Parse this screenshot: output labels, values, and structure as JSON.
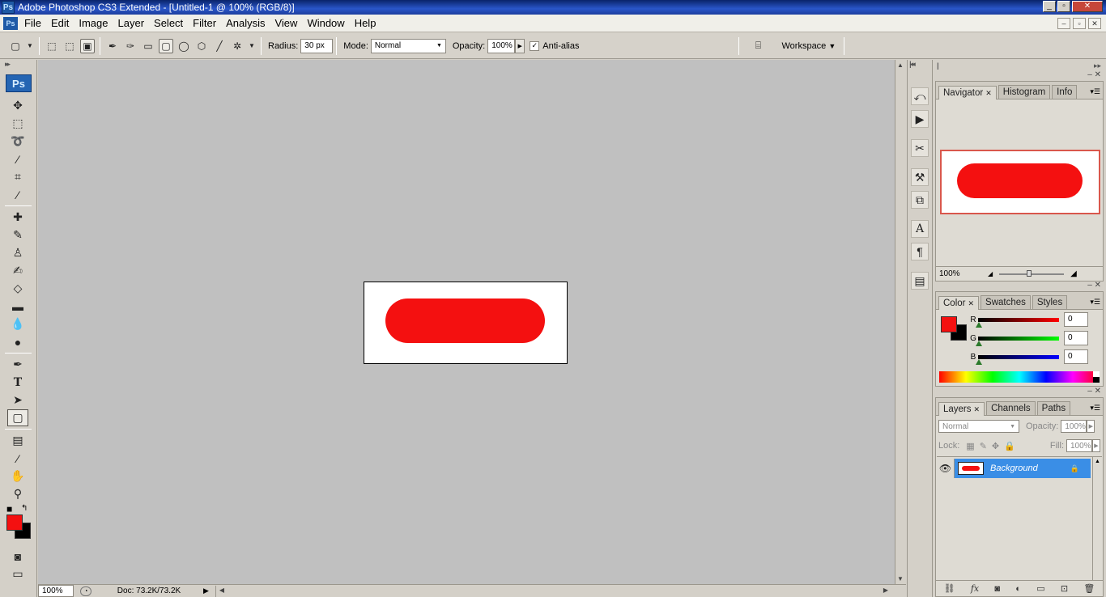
{
  "app": {
    "title": "Adobe Photoshop CS3 Extended - [Untitled-1 @ 100% (RGB/8)]",
    "logo": "Ps"
  },
  "window_controls": {
    "minimize": "_",
    "restore": "▫",
    "close": "✕"
  },
  "doc_controls": {
    "minimize": "–",
    "restore": "▫",
    "close": "✕"
  },
  "menu": [
    "File",
    "Edit",
    "Image",
    "Layer",
    "Select",
    "Filter",
    "Analysis",
    "View",
    "Window",
    "Help"
  ],
  "options": {
    "radius_label": "Radius:",
    "radius_value": "30 px",
    "mode_label": "Mode:",
    "mode_value": "Normal",
    "opacity_label": "Opacity:",
    "opacity_value": "100%",
    "antialias_label": "Anti-alias",
    "antialias_checked": true,
    "workspace_label": "Workspace"
  },
  "toolbox": {
    "logo": "Ps",
    "foreground_color": "#f41010",
    "background_color": "#000000"
  },
  "canvas": {
    "background": "#c0c0c0",
    "shape_color": "#f41010"
  },
  "status": {
    "zoom": "100%",
    "doc_info": "Doc: 73.2K/73.2K"
  },
  "navigator_panel": {
    "tabs": [
      "Navigator",
      "Histogram",
      "Info"
    ],
    "active_tab": "Navigator",
    "zoom": "100%"
  },
  "color_panel": {
    "tabs": [
      "Color",
      "Swatches",
      "Styles"
    ],
    "active_tab": "Color",
    "channels": [
      {
        "name": "R",
        "value": "0"
      },
      {
        "name": "G",
        "value": "0"
      },
      {
        "name": "B",
        "value": "0"
      }
    ]
  },
  "layers_panel": {
    "tabs": [
      "Layers",
      "Channels",
      "Paths"
    ],
    "active_tab": "Layers",
    "blend_mode": "Normal",
    "opacity_label": "Opacity:",
    "opacity_value": "100%",
    "lock_label": "Lock:",
    "fill_label": "Fill:",
    "fill_value": "100%",
    "layers": [
      {
        "name": "Background",
        "selected": true
      }
    ]
  }
}
